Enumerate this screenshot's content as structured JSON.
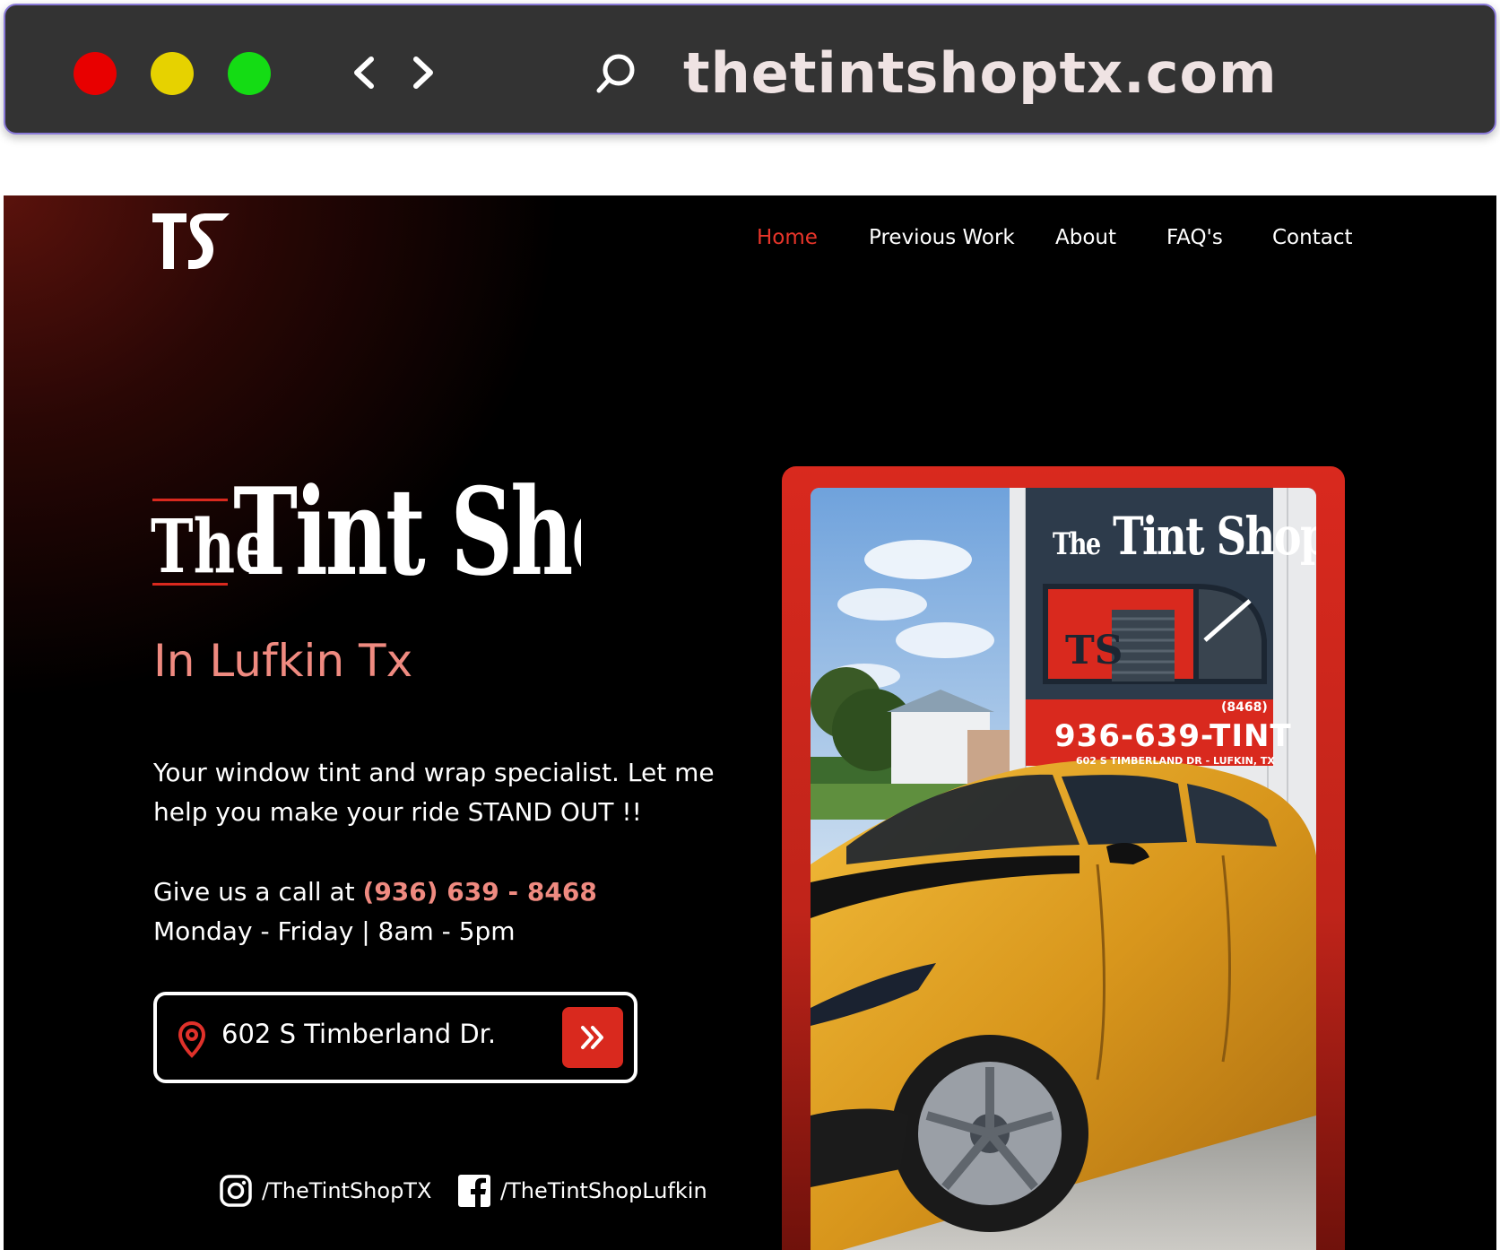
{
  "browser": {
    "url": "thetintshoptx.com",
    "back_icon": "chevron-left-icon",
    "forward_icon": "chevron-right-icon",
    "search_icon": "search-icon"
  },
  "site": {
    "nav": {
      "home": "Home",
      "previous_work": "Previous Work",
      "about": "About",
      "faqs": "FAQ's",
      "contact": "Contact"
    },
    "brand": {
      "logo_mark": "TS",
      "name": "The Tint Shop"
    },
    "hero": {
      "tagline": "In Lufkin Tx",
      "description": "Your window tint and wrap specialist. Let me help you make your ride STAND OUT !!",
      "call_prefix": "Give us a call at ",
      "phone": "(936) 639 - 8468",
      "hours": "Monday - Friday | 8am - 5pm",
      "address": "602 S Timberland Dr."
    },
    "social": {
      "instagram": "/TheTintShopTX",
      "facebook": "/TheTintShopLufkin"
    },
    "photo_sign": {
      "title_the": "The",
      "title_rest": "Tint Shop",
      "number": "936-639-TINT",
      "extension": "(8468)",
      "address": "602 S TIMBERLAND DR - LUFKIN, TX"
    },
    "colors": {
      "accent_red": "#d9291e",
      "tagline_pink": "#ef8a80",
      "active_nav": "#e8352a"
    }
  }
}
